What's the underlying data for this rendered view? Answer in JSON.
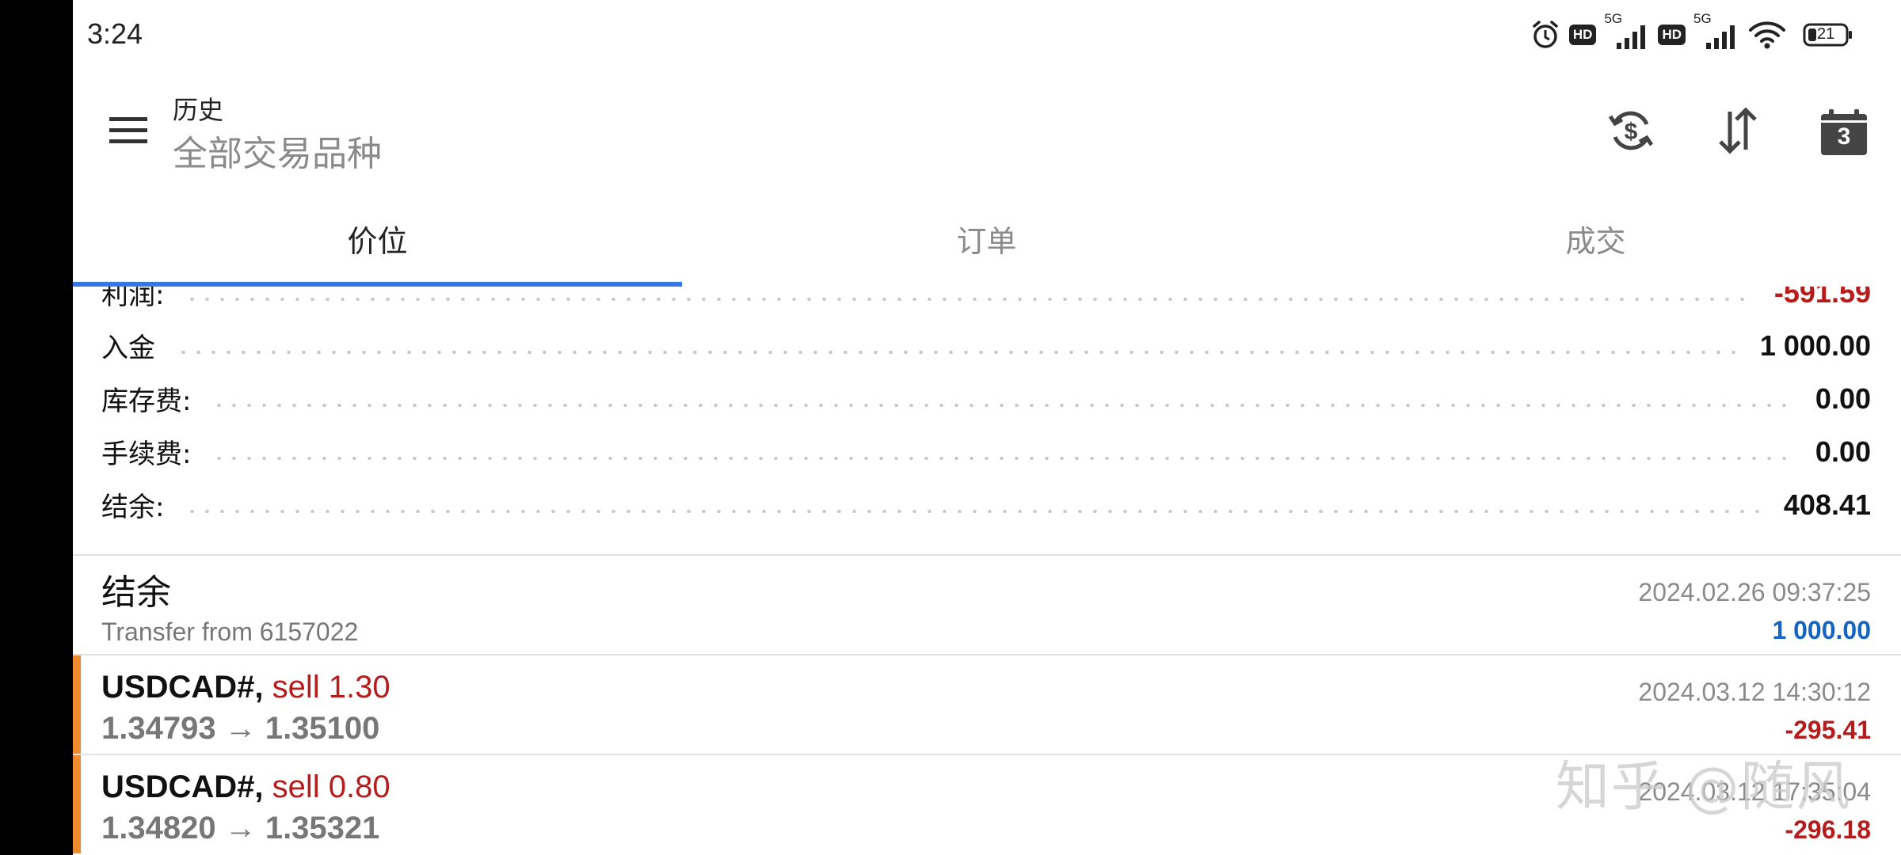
{
  "status_bar": {
    "time": "3:24",
    "network_1": "5G",
    "network_2": "5G",
    "hd_label": "HD",
    "battery": "21",
    "icons": [
      "alarm-icon",
      "hd-icon",
      "signal-icon",
      "hd-icon",
      "signal-icon",
      "wifi-icon",
      "battery-icon"
    ]
  },
  "app_bar": {
    "title": "历史",
    "subtitle": "全部交易品种",
    "calendar_day": "3",
    "icons": [
      "menu-icon",
      "currency-sync-icon",
      "sort-icon",
      "calendar-icon"
    ]
  },
  "tabs": [
    {
      "label": "价位",
      "active": true
    },
    {
      "label": "订单",
      "active": false
    },
    {
      "label": "成交",
      "active": false
    }
  ],
  "summary": {
    "profit": {
      "label": "利润:",
      "value": "-591.59"
    },
    "deposit": {
      "label": "入金",
      "value": "1 000.00"
    },
    "swap": {
      "label": "库存费:",
      "value": "0.00"
    },
    "commission": {
      "label": "手续费:",
      "value": "0.00"
    },
    "balance": {
      "label": "结余:",
      "value": "408.41"
    }
  },
  "history": [
    {
      "title": "结余",
      "subtitle": "Transfer from 6157022",
      "time": "2024.02.26 09:37:25",
      "amount": "1 000.00"
    },
    {
      "symbol": "USDCAD#,",
      "side": " sell 1.30",
      "prices": "1.34793 → 1.35100",
      "time": "2024.03.12 14:30:12",
      "amount": "-295.41"
    },
    {
      "symbol": "USDCAD#,",
      "side": " sell 0.80",
      "prices": "1.34820 → 1.35321",
      "time": "2024.03.12 17:35:04",
      "amount": "-296.18"
    }
  ],
  "watermark": "知乎 @随风",
  "colors": {
    "accent": "#3578e5",
    "negative": "#b71c1c",
    "positive": "#1565c0",
    "stripe": "#f08a30"
  }
}
